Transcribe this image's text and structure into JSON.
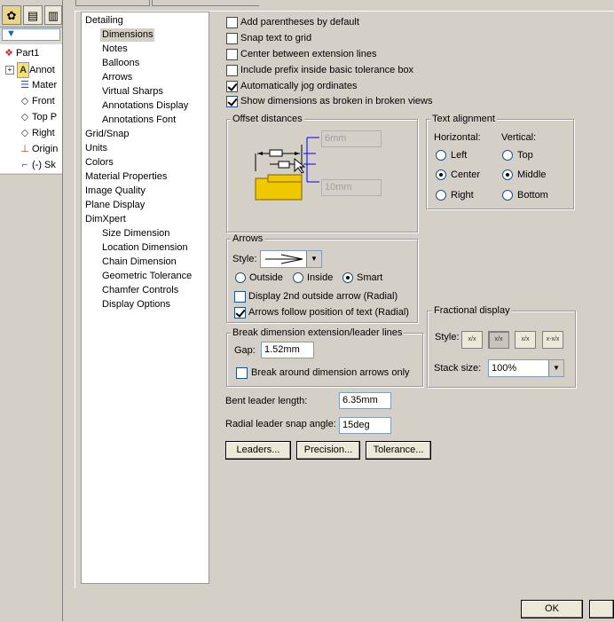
{
  "feature_tree": {
    "tabs": [
      "feature-manager-tab",
      "property-manager-tab",
      "configuration-manager-tab"
    ],
    "items": [
      {
        "label": "Part1",
        "icon": "part-icon"
      },
      {
        "label": "Annot",
        "icon": "annotations-icon"
      },
      {
        "label": "Mater",
        "icon": "material-icon"
      },
      {
        "label": "Front",
        "icon": "plane-icon"
      },
      {
        "label": "Top P",
        "icon": "plane-icon"
      },
      {
        "label": "Right",
        "icon": "plane-icon"
      },
      {
        "label": "Origin",
        "icon": "origin-icon"
      },
      {
        "label": "(-) Sk",
        "icon": "sketch-icon"
      }
    ]
  },
  "categories": [
    {
      "label": "Detailing"
    },
    {
      "label": "Dimensions"
    },
    {
      "label": "Notes"
    },
    {
      "label": "Balloons"
    },
    {
      "label": "Arrows"
    },
    {
      "label": "Virtual Sharps"
    },
    {
      "label": "Annotations Display"
    },
    {
      "label": "Annotations Font"
    },
    {
      "label": "Grid/Snap"
    },
    {
      "label": "Units"
    },
    {
      "label": "Colors"
    },
    {
      "label": "Material Properties"
    },
    {
      "label": "Image Quality"
    },
    {
      "label": "Plane Display"
    },
    {
      "label": "DimXpert"
    },
    {
      "label": "Size Dimension"
    },
    {
      "label": "Location Dimension"
    },
    {
      "label": "Chain Dimension"
    },
    {
      "label": "Geometric Tolerance"
    },
    {
      "label": "Chamfer Controls"
    },
    {
      "label": "Display Options"
    }
  ],
  "options": [
    {
      "label": "Add parentheses by default",
      "checked": false
    },
    {
      "label": "Snap text to grid",
      "checked": false
    },
    {
      "label": "Center between extension lines",
      "checked": false
    },
    {
      "label": "Include prefix inside basic tolerance box",
      "checked": false
    },
    {
      "label": "Automatically jog ordinates",
      "checked": true
    },
    {
      "label": "Show dimensions as broken in broken views",
      "checked": true
    }
  ],
  "offset": {
    "title": "Offset distances",
    "value1": "6mm",
    "value2": "10mm"
  },
  "text_alignment": {
    "title": "Text alignment",
    "horizontal_label": "Horizontal:",
    "vertical_label": "Vertical:",
    "horizontal": [
      "Left",
      "Center",
      "Right"
    ],
    "vertical": [
      "Top",
      "Middle",
      "Bottom"
    ],
    "selected_horizontal": "Center",
    "selected_vertical": "Middle"
  },
  "arrows": {
    "title": "Arrows",
    "style_label": "Style:",
    "positions": [
      "Outside",
      "Inside",
      "Smart"
    ],
    "selected_position": "Smart",
    "display_2nd": "Display 2nd outside arrow (Radial)",
    "follow_text": "Arrows follow position of text (Radial)"
  },
  "break": {
    "title": "Break dimension extension/leader lines",
    "gap_label": "Gap:",
    "gap_value": "1.52mm",
    "around_arrows": "Break around dimension arrows only"
  },
  "fractional": {
    "title": "Fractional display",
    "style_label": "Style:",
    "stack_label": "Stack size:",
    "stack_value": "100%",
    "styles": [
      "x/x",
      "x over x",
      "x diagonal x",
      "x-x/x"
    ]
  },
  "bent_leader": {
    "label": "Bent leader length:",
    "value": "6.35mm"
  },
  "radial_snap": {
    "label": "Radial leader snap angle:",
    "value": "15deg"
  },
  "buttons": {
    "leaders": "Leaders...",
    "precision": "Precision...",
    "tolerance": "Tolerance...",
    "ok": "OK"
  },
  "colors": {
    "dim_line": "#0000ff",
    "part_fill": "#f0c800",
    "selected_bg": "#d4d0c8"
  }
}
